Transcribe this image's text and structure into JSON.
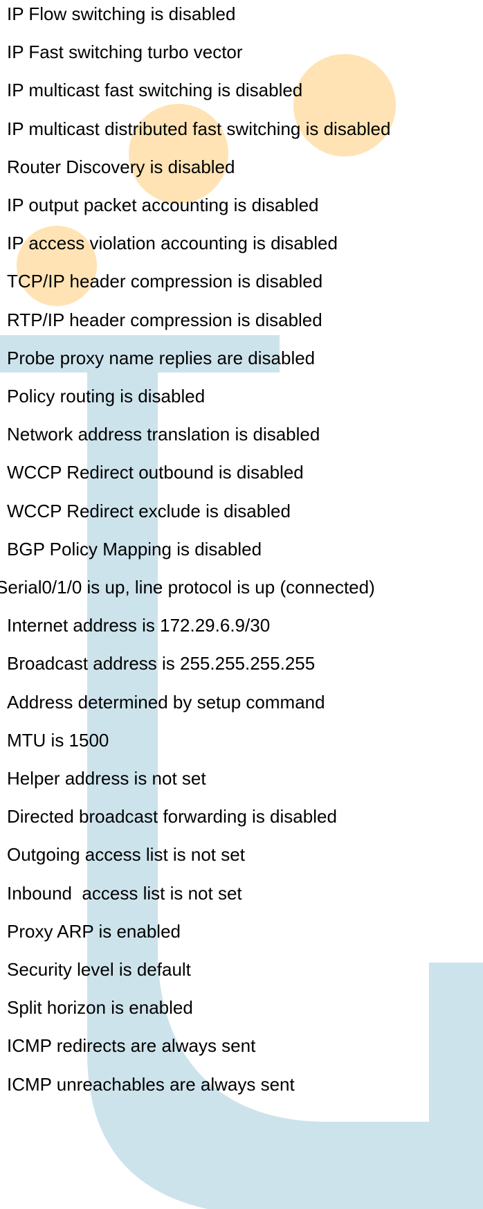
{
  "colors": {
    "background": "#ffffff",
    "text": "#000000",
    "watermark_blue": "#cde3ec",
    "decor_orange": "#ffe3b4"
  },
  "lines": [
    {
      "text": "IP Flow switching is disabled"
    },
    {
      "text": "IP Fast switching turbo vector"
    },
    {
      "text": "IP multicast fast switching is disabled"
    },
    {
      "text": "IP multicast distributed fast switching is disabled"
    },
    {
      "text": "Router Discovery is disabled"
    },
    {
      "text": "IP output packet accounting is disabled"
    },
    {
      "text": "IP access violation accounting is disabled"
    },
    {
      "text": "TCP/IP header compression is disabled"
    },
    {
      "text": "RTP/IP header compression is disabled"
    },
    {
      "text": "Probe proxy name replies are disabled"
    },
    {
      "text": "Policy routing is disabled"
    },
    {
      "text": "Network address translation is disabled"
    },
    {
      "text": "WCCP Redirect outbound is disabled"
    },
    {
      "text": "WCCP Redirect exclude is disabled"
    },
    {
      "text": "BGP Policy Mapping is disabled"
    },
    {
      "text": "Serial0/1/0 is up, line protocol is up (connected)",
      "outdent": true
    },
    {
      "text": "Internet address is 172.29.6.9/30"
    },
    {
      "text": "Broadcast address is 255.255.255.255"
    },
    {
      "text": "Address determined by setup command"
    },
    {
      "text": "MTU is 1500"
    },
    {
      "text": "Helper address is not set"
    },
    {
      "text": "Directed broadcast forwarding is disabled"
    },
    {
      "text": "Outgoing access list is not set"
    },
    {
      "text": "Inbound  access list is not set"
    },
    {
      "text": "Proxy ARP is enabled"
    },
    {
      "text": "Security level is default"
    },
    {
      "text": "Split horizon is enabled"
    },
    {
      "text": "ICMP redirects are always sent"
    },
    {
      "text": "ICMP unreachables are always sent"
    }
  ]
}
